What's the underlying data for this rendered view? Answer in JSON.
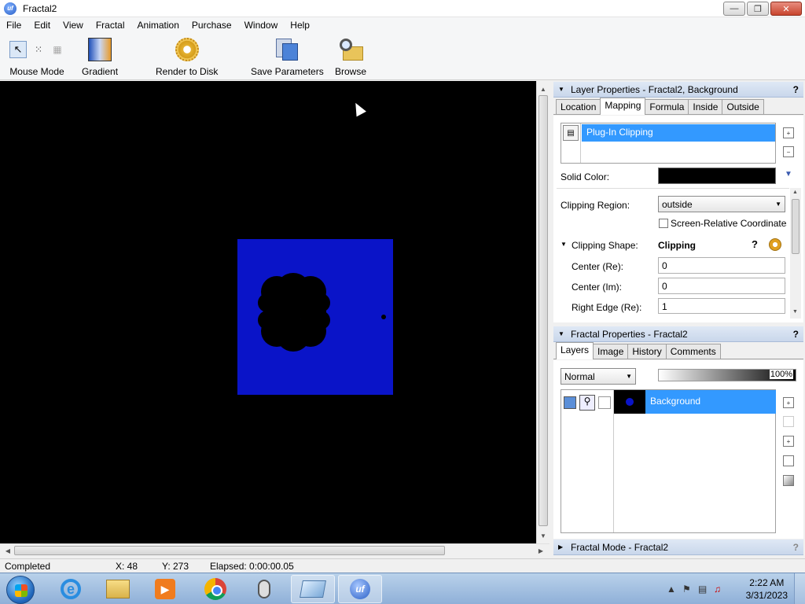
{
  "window": {
    "title": "Fractal2",
    "app_icon": "uf"
  },
  "menu": [
    "File",
    "Edit",
    "View",
    "Fractal",
    "Animation",
    "Purchase",
    "Window",
    "Help"
  ],
  "toolbar": {
    "mouse_mode": "Mouse Mode",
    "gradient": "Gradient",
    "render": "Render to Disk",
    "save": "Save Parameters",
    "browse": "Browse"
  },
  "layer_props": {
    "header": "Layer Properties - Fractal2, Background",
    "help": "?",
    "tabs": [
      "Location",
      "Mapping",
      "Formula",
      "Inside",
      "Outside"
    ],
    "active_tab": "Mapping",
    "plugin_item": "Plug-In Clipping",
    "solid_color_label": "Solid Color:",
    "solid_color": "#000000",
    "clipping_region_label": "Clipping Region:",
    "clipping_region_value": "outside",
    "screen_relative_label": "Screen-Relative Coordinates",
    "clipping_shape_label": "Clipping Shape:",
    "clipping_shape_value": "Clipping",
    "center_re_label": "Center (Re):",
    "center_re": "0",
    "center_im_label": "Center (Im):",
    "center_im": "0",
    "right_edge_label": "Right Edge (Re):",
    "right_edge": "1"
  },
  "fractal_props": {
    "header": "Fractal Properties - Fractal2",
    "help": "?",
    "tabs": [
      "Layers",
      "Image",
      "History",
      "Comments"
    ],
    "active_tab": "Layers",
    "blend_mode": "Normal",
    "opacity": "100%",
    "layer_name": "Background"
  },
  "fractal_mode": {
    "header": "Fractal Mode - Fractal2",
    "help": "?"
  },
  "status": {
    "state": "Completed",
    "x": "X: 48",
    "y": "Y: 273",
    "elapsed": "Elapsed: 0:00:00.05"
  },
  "taskbar": {
    "time": "2:22 AM",
    "date": "3/31/2023",
    "uf_label": "uf"
  },
  "colors": {
    "selection": "#3399ff",
    "fractal_blue": "#0a14c8"
  }
}
